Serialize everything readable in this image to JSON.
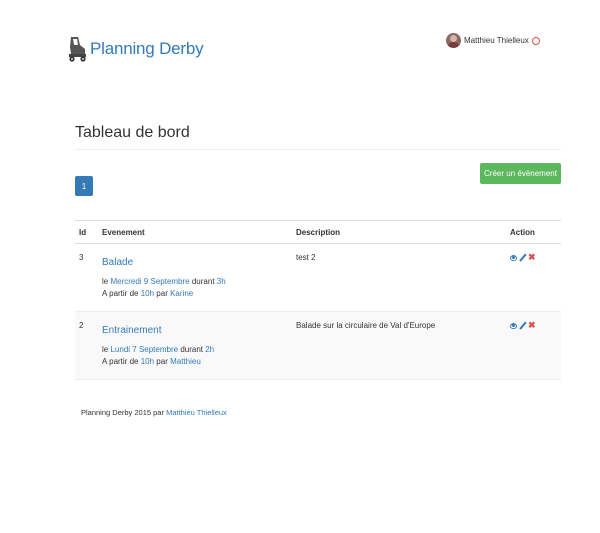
{
  "brand": {
    "title": "Planning Derby"
  },
  "user": {
    "name": "Matthieu Thielleux"
  },
  "page": {
    "title": "Tableau de bord"
  },
  "pagination": {
    "current": "1"
  },
  "actions": {
    "create_label": "Créer un évènement"
  },
  "table": {
    "headers": {
      "id": "Id",
      "event": "Evenement",
      "description": "Description",
      "action": "Action"
    },
    "rows": [
      {
        "id": "3",
        "title": "Balade",
        "line1_prefix": "le",
        "date": "Mercredi 9 Septembre",
        "durant": "durant",
        "duration": "3h",
        "line2_prefix": "A partir de",
        "time": "10h",
        "par": "par",
        "author": "Karine",
        "description": "test 2"
      },
      {
        "id": "2",
        "title": "Entrainement",
        "line1_prefix": "le",
        "date": "Lundi 7 Septembre",
        "durant": "durant",
        "duration": "2h",
        "line2_prefix": "A partir de",
        "time": "10h",
        "par": "par",
        "author": "Matthieu",
        "description": "Balade sur la circulaire de Val d'Europe"
      }
    ]
  },
  "footer": {
    "text": "Planning Derby 2015 par",
    "author": "Matthieu Thielleux"
  },
  "colors": {
    "primary": "#337ab7",
    "success": "#5cb85c",
    "danger": "#d9534f"
  },
  "icons": [
    "skate-logo",
    "avatar",
    "power-icon",
    "eye-icon",
    "pencil-icon",
    "remove-icon"
  ]
}
